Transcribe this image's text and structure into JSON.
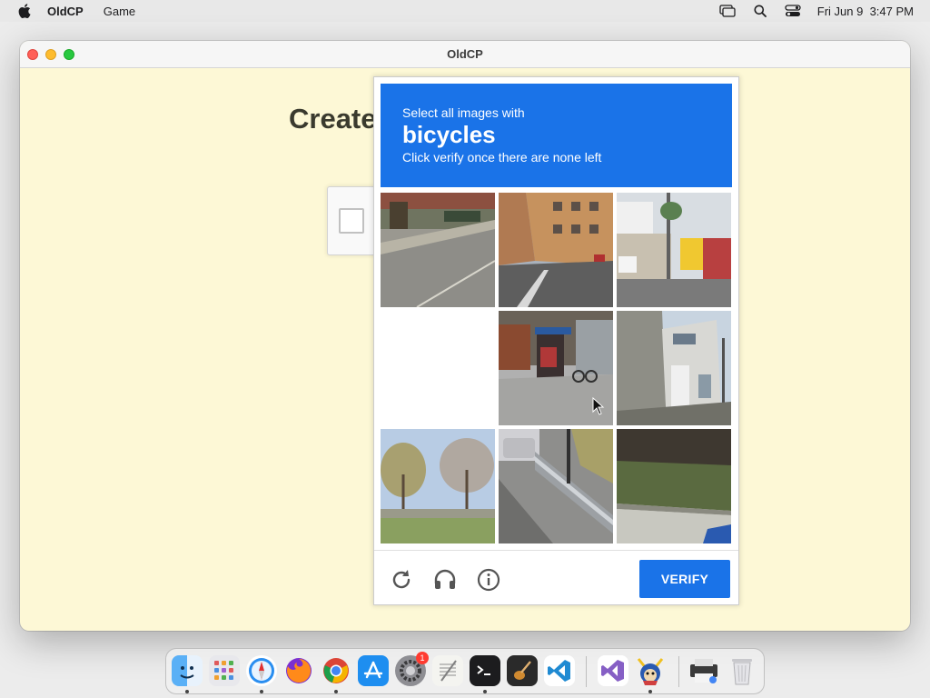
{
  "menubar": {
    "app_name": "OldCP",
    "menu_items": [
      "Game"
    ],
    "clock": "Fri Jun 9  3:47 PM",
    "icons": [
      "apple-icon",
      "screen-mirroring-icon",
      "spotlight-search-icon",
      "control-center-icon"
    ]
  },
  "window": {
    "title": "OldCP",
    "page_heading": "Create"
  },
  "captcha": {
    "instruction_line1": "Select all images with",
    "keyword": "bicycles",
    "instruction_line3": "Click verify once there are none left",
    "verify_label": "VERIFY",
    "tiles": [
      "street-corner-tile",
      "city-street-tile",
      "shop-front-tile",
      "empty-tile",
      "bus-stop-tile",
      "house-alley-tile",
      "park-trees-tile",
      "guardrail-road-tile",
      "grass-verge-tile"
    ],
    "footer_icons": [
      "reload-icon",
      "audio-headphones-icon",
      "info-icon"
    ],
    "colors": {
      "header": "#1a73e8",
      "button": "#1a73e8"
    }
  },
  "dock": {
    "apps": [
      "finder",
      "launchpad",
      "safari",
      "firefox",
      "chrome",
      "app-store",
      "system-settings",
      "textedit",
      "terminal",
      "garageband",
      "vscode",
      "visual-studio",
      "game",
      "printer",
      "trash"
    ],
    "system_settings_badge": "1"
  }
}
